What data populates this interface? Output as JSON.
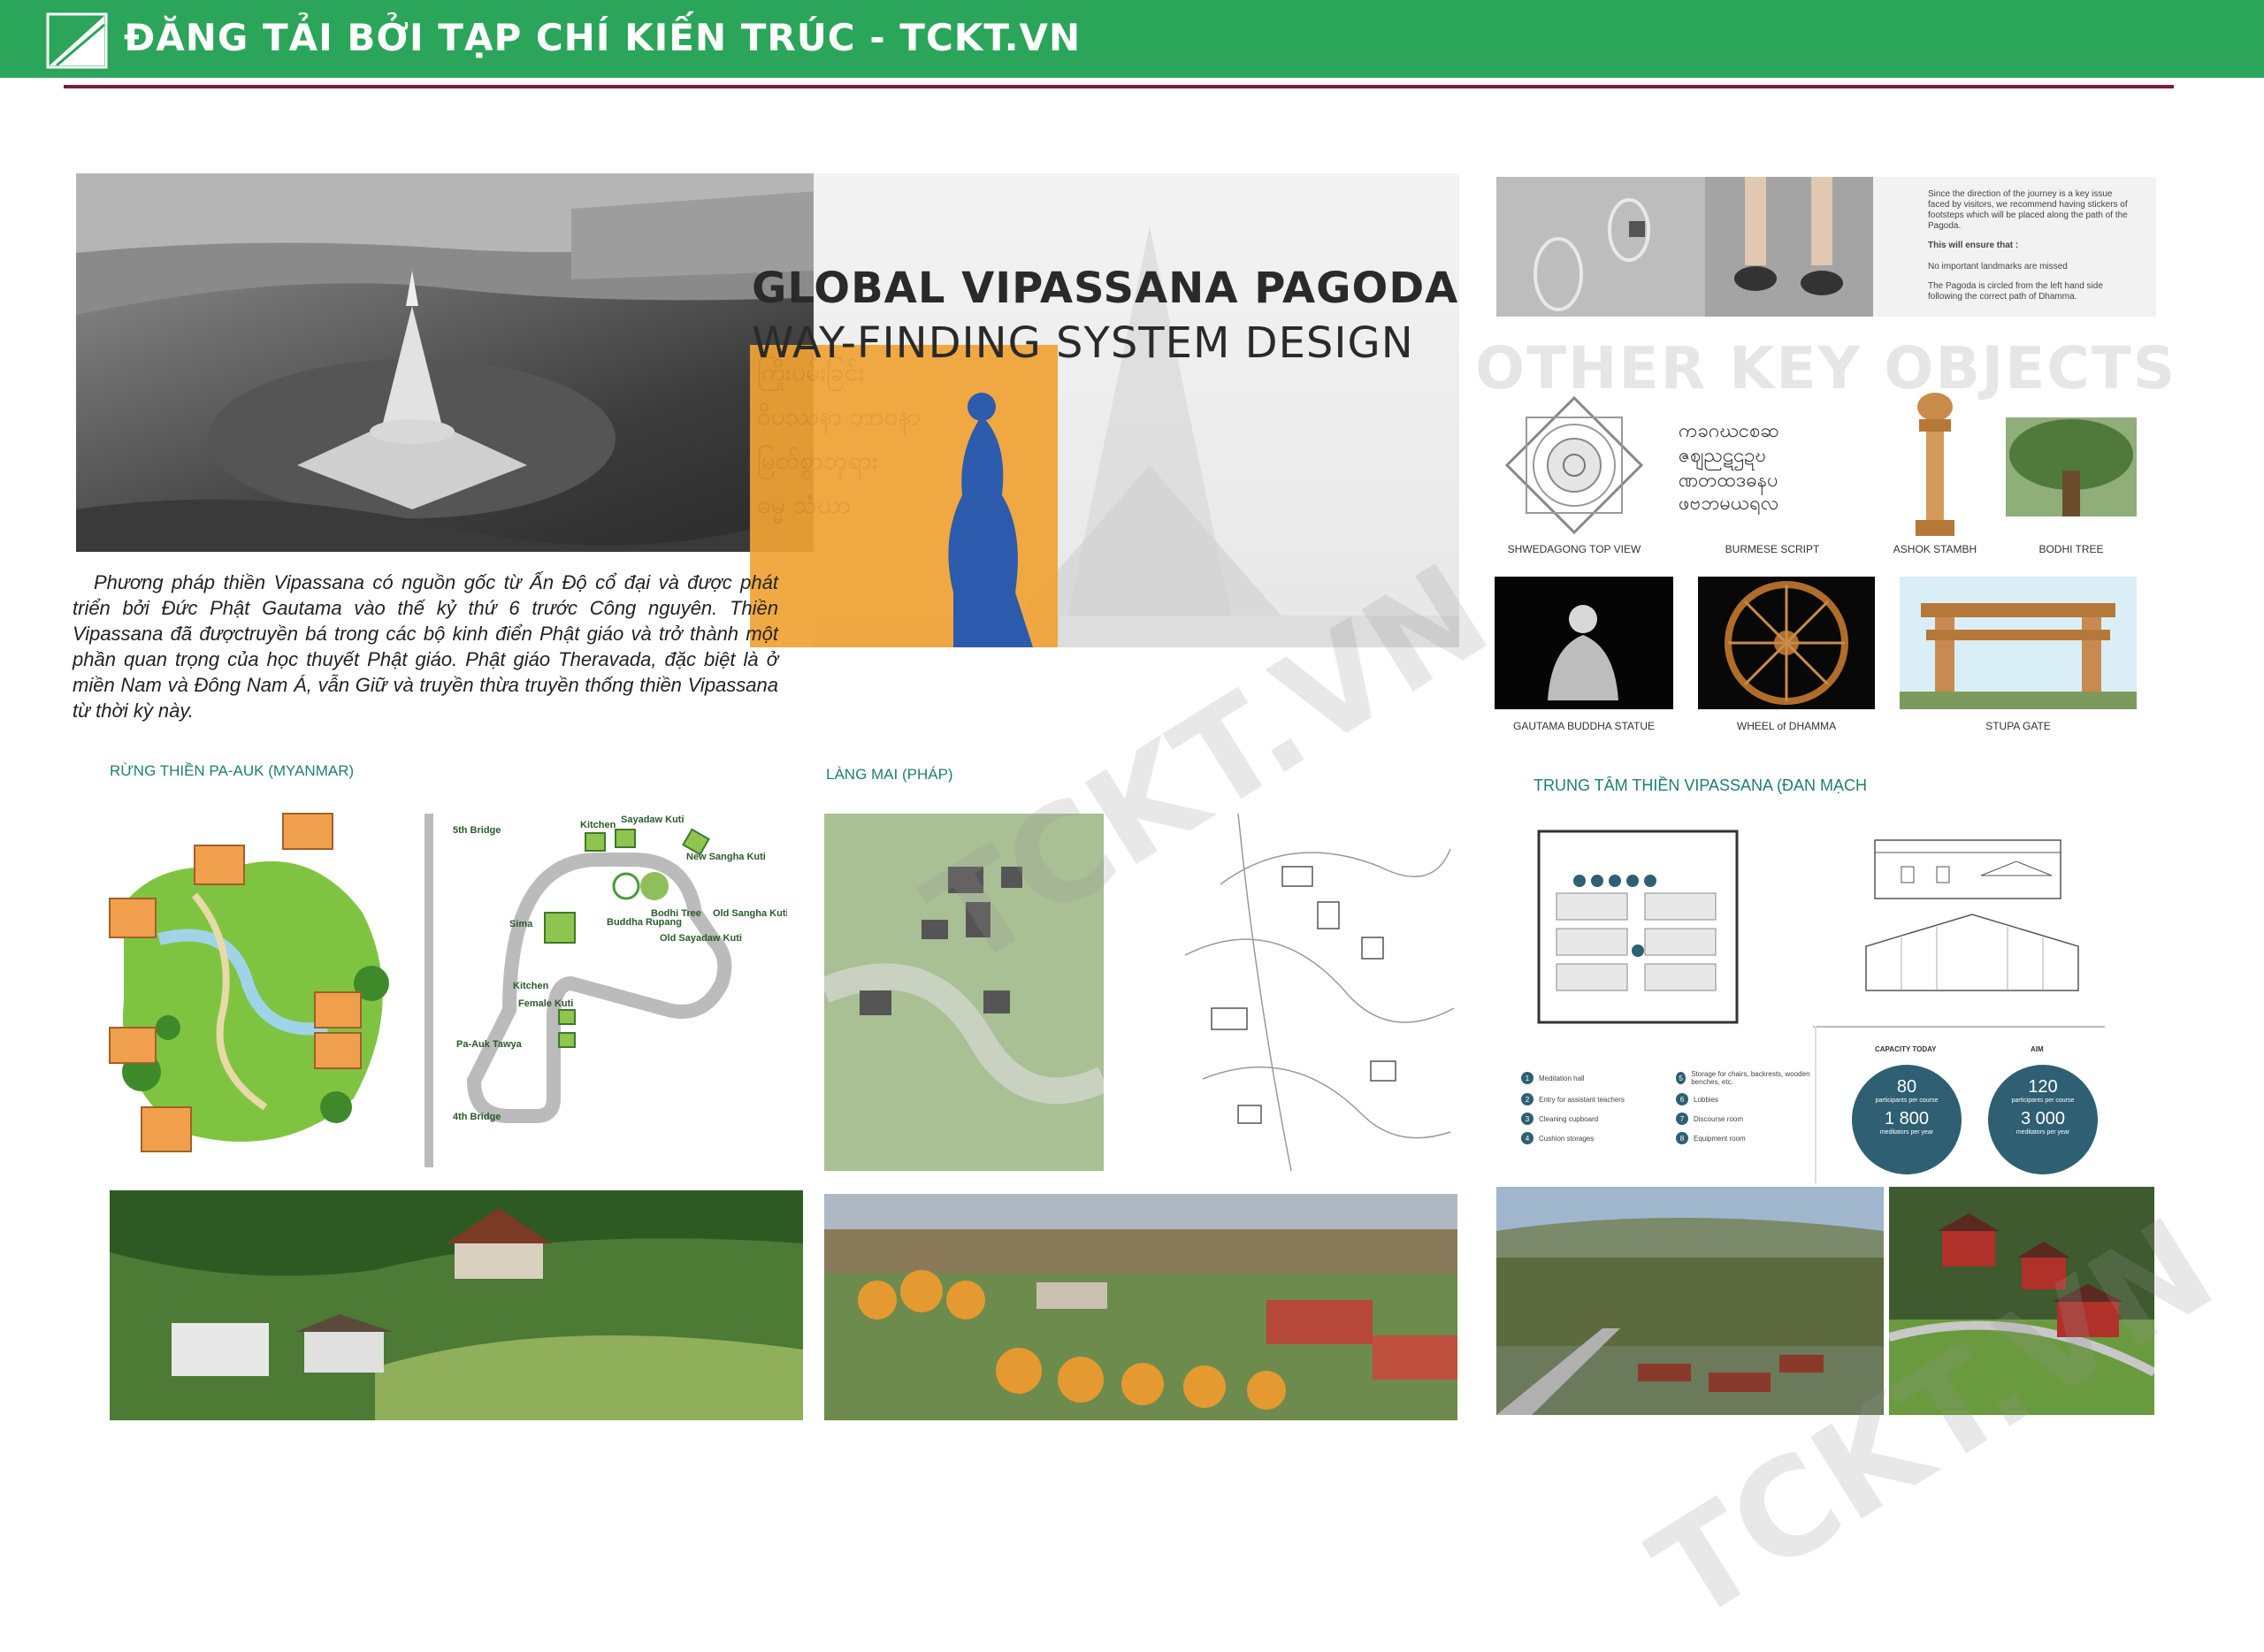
{
  "banner": {
    "title": "ĐĂNG TẢI BỞI TẠP CHÍ KIẾN TRÚC - TCKT.VN"
  },
  "hero": {
    "title_line1": "GLOBAL VIPASSANA PAGODA",
    "title_line2": "WAY-FINDING SYSTEM DESIGN",
    "intro": "Phương pháp thiền Vipassana có nguồn gốc từ Ấn Độ cổ đại và được phát triển bởi Đức Phật Gautama vào thế kỷ thứ 6 trước Công nguyên. Thiền Vipassana đã đượctruyền bá trong các bộ kinh điển Phật giáo và trở thành một phần quan trọng của học thuyết Phật giáo. Phật giáo Theravada, đặc biệt là ở miền Nam và Đông Nam Á, vẫn Giữ và truyền thừa truyền thống thiền Vipassana từ thời kỳ này."
  },
  "footsteps": {
    "note1": "Since the direction of the journey is a key issue faced by visitors, we recommend having stickers of footsteps which will be placed along the path of the Pagoda.",
    "note2": "This will ensure that :",
    "note3": "No important landmarks are missed",
    "note4": "The Pagoda is circled from the left hand side following the correct path of Dhamma."
  },
  "key_objects": {
    "heading": "OTHER KEY OBJECTS",
    "items": [
      {
        "label": "SHWEDAGONG TOP VIEW"
      },
      {
        "label": "BURMESE SCRIPT"
      },
      {
        "label": "ASHOK STAMBH"
      },
      {
        "label": "BODHI TREE"
      },
      {
        "label": "GAUTAMA BUDDHA STATUE"
      },
      {
        "label": "WHEEL of DHAMMA"
      },
      {
        "label": "STUPA GATE"
      }
    ]
  },
  "sections": {
    "paauk": "RỪNG THIỀN PA-AUK (MYANMAR)",
    "langmai": "LÀNG MAI (PHÁP)",
    "denmark": "TRUNG TÂM THIỀN VIPASSANA (ĐAN MẠCH"
  },
  "paauk_map": {
    "labels": [
      "5th Bridge",
      "Kitchen",
      "Sayadaw Kuti",
      "New Sangha Kuti",
      "Sima",
      "Buddha Rupang",
      "Bodhi Tree",
      "Old Sayadaw Kuti",
      "Old Sangha Kuti",
      "Kitchen",
      "Female Kuti",
      "Pa-Auk Tawya",
      "4th Bridge"
    ]
  },
  "denmark_plan": {
    "legend": [
      {
        "n": "1",
        "text": "Meditation hall"
      },
      {
        "n": "2",
        "text": "Entry for assistant teachers"
      },
      {
        "n": "3",
        "text": "Cleaning cupboard"
      },
      {
        "n": "4",
        "text": "Cushion storages"
      },
      {
        "n": "5",
        "text": "Storage for chairs, backrests, wooden benches, etc."
      },
      {
        "n": "6",
        "text": "Lobbies"
      },
      {
        "n": "7",
        "text": "Discourse room"
      },
      {
        "n": "8",
        "text": "Equipment room"
      }
    ],
    "capacity_today_label": "CAPACITY TODAY",
    "aim_label": "AIM",
    "today_participants": "80",
    "today_participants_sub": "participants per course",
    "today_meditators": "1 800",
    "today_meditators_sub": "meditators per year",
    "aim_participants": "120",
    "aim_participants_sub": "participants per course",
    "aim_meditators": "3 000",
    "aim_meditators_sub": "meditators per year"
  },
  "watermark": {
    "text": "TCKT.VN"
  },
  "colors": {
    "banner": "#2aa55a",
    "rule": "#7b1d33",
    "orange": "#f0a334",
    "buddha_blue": "#1d4fa8",
    "section_heading": "#1f7f6f",
    "circle": "#2e5f73"
  }
}
